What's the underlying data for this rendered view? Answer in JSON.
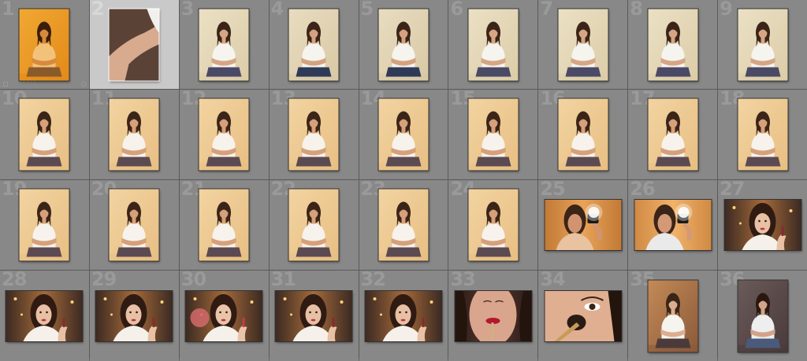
{
  "grid": {
    "columns": 9,
    "cells": [
      {
        "n": "1",
        "orient": "portrait",
        "scene": "orange",
        "selected": false
      },
      {
        "n": "2",
        "orient": "portrait",
        "scene": "arm",
        "selected": true
      },
      {
        "n": "3",
        "orient": "portrait",
        "scene": "sit",
        "selected": false
      },
      {
        "n": "4",
        "orient": "portrait",
        "scene": "sit-dark",
        "selected": false
      },
      {
        "n": "5",
        "orient": "portrait",
        "scene": "sit-dark",
        "selected": false
      },
      {
        "n": "6",
        "orient": "portrait",
        "scene": "sit",
        "selected": false
      },
      {
        "n": "7",
        "orient": "portrait",
        "scene": "sit",
        "selected": false
      },
      {
        "n": "8",
        "orient": "portrait",
        "scene": "sit",
        "selected": false
      },
      {
        "n": "9",
        "orient": "portrait",
        "scene": "sit",
        "selected": false
      },
      {
        "n": "10",
        "orient": "portrait",
        "scene": "sit-warm",
        "selected": false
      },
      {
        "n": "11",
        "orient": "portrait",
        "scene": "sit-warm",
        "selected": false
      },
      {
        "n": "12",
        "orient": "portrait",
        "scene": "sit-warm",
        "selected": false
      },
      {
        "n": "13",
        "orient": "portrait",
        "scene": "sit-warm",
        "selected": false
      },
      {
        "n": "14",
        "orient": "portrait",
        "scene": "sit-warm",
        "selected": false
      },
      {
        "n": "15",
        "orient": "portrait",
        "scene": "sit-warm",
        "selected": false
      },
      {
        "n": "16",
        "orient": "portrait",
        "scene": "sit-warm",
        "selected": false
      },
      {
        "n": "17",
        "orient": "portrait",
        "scene": "sit-warm",
        "selected": false
      },
      {
        "n": "18",
        "orient": "portrait",
        "scene": "sit-warm",
        "selected": false
      },
      {
        "n": "19",
        "orient": "portrait",
        "scene": "sit-warm",
        "selected": false
      },
      {
        "n": "20",
        "orient": "portrait",
        "scene": "sit-warm",
        "selected": false
      },
      {
        "n": "21",
        "orient": "portrait",
        "scene": "sit-warm",
        "selected": false
      },
      {
        "n": "22",
        "orient": "portrait",
        "scene": "sit-warm",
        "selected": false
      },
      {
        "n": "23",
        "orient": "portrait",
        "scene": "sit-warm",
        "selected": false
      },
      {
        "n": "24",
        "orient": "portrait",
        "scene": "sit-warm",
        "selected": false
      },
      {
        "n": "25",
        "orient": "landscape",
        "scene": "mirror",
        "selected": false
      },
      {
        "n": "26",
        "orient": "landscape",
        "scene": "mirror2",
        "selected": false
      },
      {
        "n": "27",
        "orient": "landscape",
        "scene": "makeup",
        "selected": false
      },
      {
        "n": "28",
        "orient": "landscape",
        "scene": "makeup",
        "selected": false
      },
      {
        "n": "29",
        "orient": "landscape",
        "scene": "makeup",
        "selected": false
      },
      {
        "n": "30",
        "orient": "landscape",
        "scene": "makeup-brush",
        "selected": false
      },
      {
        "n": "31",
        "orient": "landscape",
        "scene": "makeup",
        "selected": false
      },
      {
        "n": "32",
        "orient": "landscape",
        "scene": "makeup",
        "selected": false
      },
      {
        "n": "33",
        "orient": "landscape",
        "scene": "lips",
        "selected": false
      },
      {
        "n": "34",
        "orient": "landscape",
        "scene": "eye",
        "selected": false
      },
      {
        "n": "35",
        "orient": "portrait",
        "scene": "room",
        "selected": false
      },
      {
        "n": "36",
        "orient": "portrait",
        "scene": "room-dark",
        "selected": false
      }
    ]
  },
  "palette": {
    "selected_cell": "#c9c9c9",
    "cell": "#888888",
    "grid_line": "#5a5a5a",
    "number": "#9a9a9a"
  }
}
